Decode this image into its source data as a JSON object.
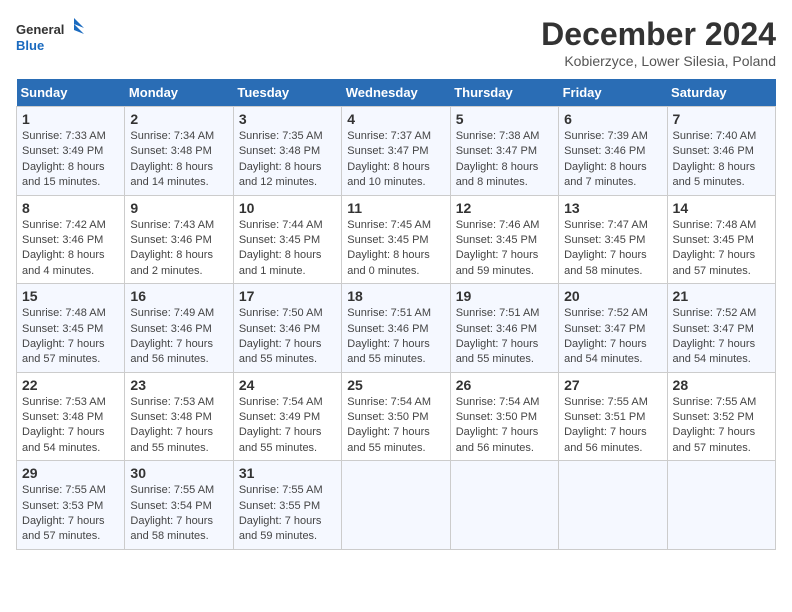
{
  "header": {
    "logo_general": "General",
    "logo_blue": "Blue",
    "title": "December 2024",
    "subtitle": "Kobierzyce, Lower Silesia, Poland"
  },
  "weekdays": [
    "Sunday",
    "Monday",
    "Tuesday",
    "Wednesday",
    "Thursday",
    "Friday",
    "Saturday"
  ],
  "weeks": [
    [
      {
        "day": "1",
        "sunrise": "7:33 AM",
        "sunset": "3:49 PM",
        "daylight": "8 hours and 15 minutes."
      },
      {
        "day": "2",
        "sunrise": "7:34 AM",
        "sunset": "3:48 PM",
        "daylight": "8 hours and 14 minutes."
      },
      {
        "day": "3",
        "sunrise": "7:35 AM",
        "sunset": "3:48 PM",
        "daylight": "8 hours and 12 minutes."
      },
      {
        "day": "4",
        "sunrise": "7:37 AM",
        "sunset": "3:47 PM",
        "daylight": "8 hours and 10 minutes."
      },
      {
        "day": "5",
        "sunrise": "7:38 AM",
        "sunset": "3:47 PM",
        "daylight": "8 hours and 8 minutes."
      },
      {
        "day": "6",
        "sunrise": "7:39 AM",
        "sunset": "3:46 PM",
        "daylight": "8 hours and 7 minutes."
      },
      {
        "day": "7",
        "sunrise": "7:40 AM",
        "sunset": "3:46 PM",
        "daylight": "8 hours and 5 minutes."
      }
    ],
    [
      {
        "day": "8",
        "sunrise": "7:42 AM",
        "sunset": "3:46 PM",
        "daylight": "8 hours and 4 minutes."
      },
      {
        "day": "9",
        "sunrise": "7:43 AM",
        "sunset": "3:46 PM",
        "daylight": "8 hours and 2 minutes."
      },
      {
        "day": "10",
        "sunrise": "7:44 AM",
        "sunset": "3:45 PM",
        "daylight": "8 hours and 1 minute."
      },
      {
        "day": "11",
        "sunrise": "7:45 AM",
        "sunset": "3:45 PM",
        "daylight": "8 hours and 0 minutes."
      },
      {
        "day": "12",
        "sunrise": "7:46 AM",
        "sunset": "3:45 PM",
        "daylight": "7 hours and 59 minutes."
      },
      {
        "day": "13",
        "sunrise": "7:47 AM",
        "sunset": "3:45 PM",
        "daylight": "7 hours and 58 minutes."
      },
      {
        "day": "14",
        "sunrise": "7:48 AM",
        "sunset": "3:45 PM",
        "daylight": "7 hours and 57 minutes."
      }
    ],
    [
      {
        "day": "15",
        "sunrise": "7:48 AM",
        "sunset": "3:45 PM",
        "daylight": "7 hours and 57 minutes."
      },
      {
        "day": "16",
        "sunrise": "7:49 AM",
        "sunset": "3:46 PM",
        "daylight": "7 hours and 56 minutes."
      },
      {
        "day": "17",
        "sunrise": "7:50 AM",
        "sunset": "3:46 PM",
        "daylight": "7 hours and 55 minutes."
      },
      {
        "day": "18",
        "sunrise": "7:51 AM",
        "sunset": "3:46 PM",
        "daylight": "7 hours and 55 minutes."
      },
      {
        "day": "19",
        "sunrise": "7:51 AM",
        "sunset": "3:46 PM",
        "daylight": "7 hours and 55 minutes."
      },
      {
        "day": "20",
        "sunrise": "7:52 AM",
        "sunset": "3:47 PM",
        "daylight": "7 hours and 54 minutes."
      },
      {
        "day": "21",
        "sunrise": "7:52 AM",
        "sunset": "3:47 PM",
        "daylight": "7 hours and 54 minutes."
      }
    ],
    [
      {
        "day": "22",
        "sunrise": "7:53 AM",
        "sunset": "3:48 PM",
        "daylight": "7 hours and 54 minutes."
      },
      {
        "day": "23",
        "sunrise": "7:53 AM",
        "sunset": "3:48 PM",
        "daylight": "7 hours and 55 minutes."
      },
      {
        "day": "24",
        "sunrise": "7:54 AM",
        "sunset": "3:49 PM",
        "daylight": "7 hours and 55 minutes."
      },
      {
        "day": "25",
        "sunrise": "7:54 AM",
        "sunset": "3:50 PM",
        "daylight": "7 hours and 55 minutes."
      },
      {
        "day": "26",
        "sunrise": "7:54 AM",
        "sunset": "3:50 PM",
        "daylight": "7 hours and 56 minutes."
      },
      {
        "day": "27",
        "sunrise": "7:55 AM",
        "sunset": "3:51 PM",
        "daylight": "7 hours and 56 minutes."
      },
      {
        "day": "28",
        "sunrise": "7:55 AM",
        "sunset": "3:52 PM",
        "daylight": "7 hours and 57 minutes."
      }
    ],
    [
      {
        "day": "29",
        "sunrise": "7:55 AM",
        "sunset": "3:53 PM",
        "daylight": "7 hours and 57 minutes."
      },
      {
        "day": "30",
        "sunrise": "7:55 AM",
        "sunset": "3:54 PM",
        "daylight": "7 hours and 58 minutes."
      },
      {
        "day": "31",
        "sunrise": "7:55 AM",
        "sunset": "3:55 PM",
        "daylight": "7 hours and 59 minutes."
      },
      null,
      null,
      null,
      null
    ]
  ]
}
